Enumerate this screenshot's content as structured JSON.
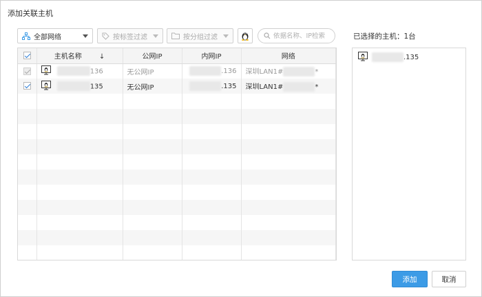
{
  "dialog": {
    "title": "添加关联主机"
  },
  "toolbar": {
    "network_select": "全部网络",
    "tag_filter_placeholder": "按标签过滤",
    "group_filter_placeholder": "按分组过滤",
    "search_placeholder": "依据名称、IP检索"
  },
  "table": {
    "columns": [
      "主机名称",
      "公网IP",
      "内网IP",
      "网络"
    ],
    "sort_indicator": "↓",
    "rows": [
      {
        "name_suffix": "136",
        "public_ip": "无公网IP",
        "private_ip_suffix": ".136",
        "network_prefix": "深圳LAN1#",
        "network_suffix": "*",
        "checked": true,
        "disabled": true
      },
      {
        "name_suffix": "135",
        "public_ip": "无公网IP",
        "private_ip_suffix": ".135",
        "network_prefix": "深圳LAN1#",
        "network_suffix": "*",
        "checked": true,
        "disabled": false
      }
    ]
  },
  "selected": {
    "title": "已选择的主机：1台",
    "items": [
      {
        "suffix": ".135"
      }
    ]
  },
  "buttons": {
    "add": "添加",
    "cancel": "取消"
  },
  "colors": {
    "primary": "#3c9be6",
    "border": "#d8d8d8",
    "checkbox": "#2d7fd8"
  }
}
